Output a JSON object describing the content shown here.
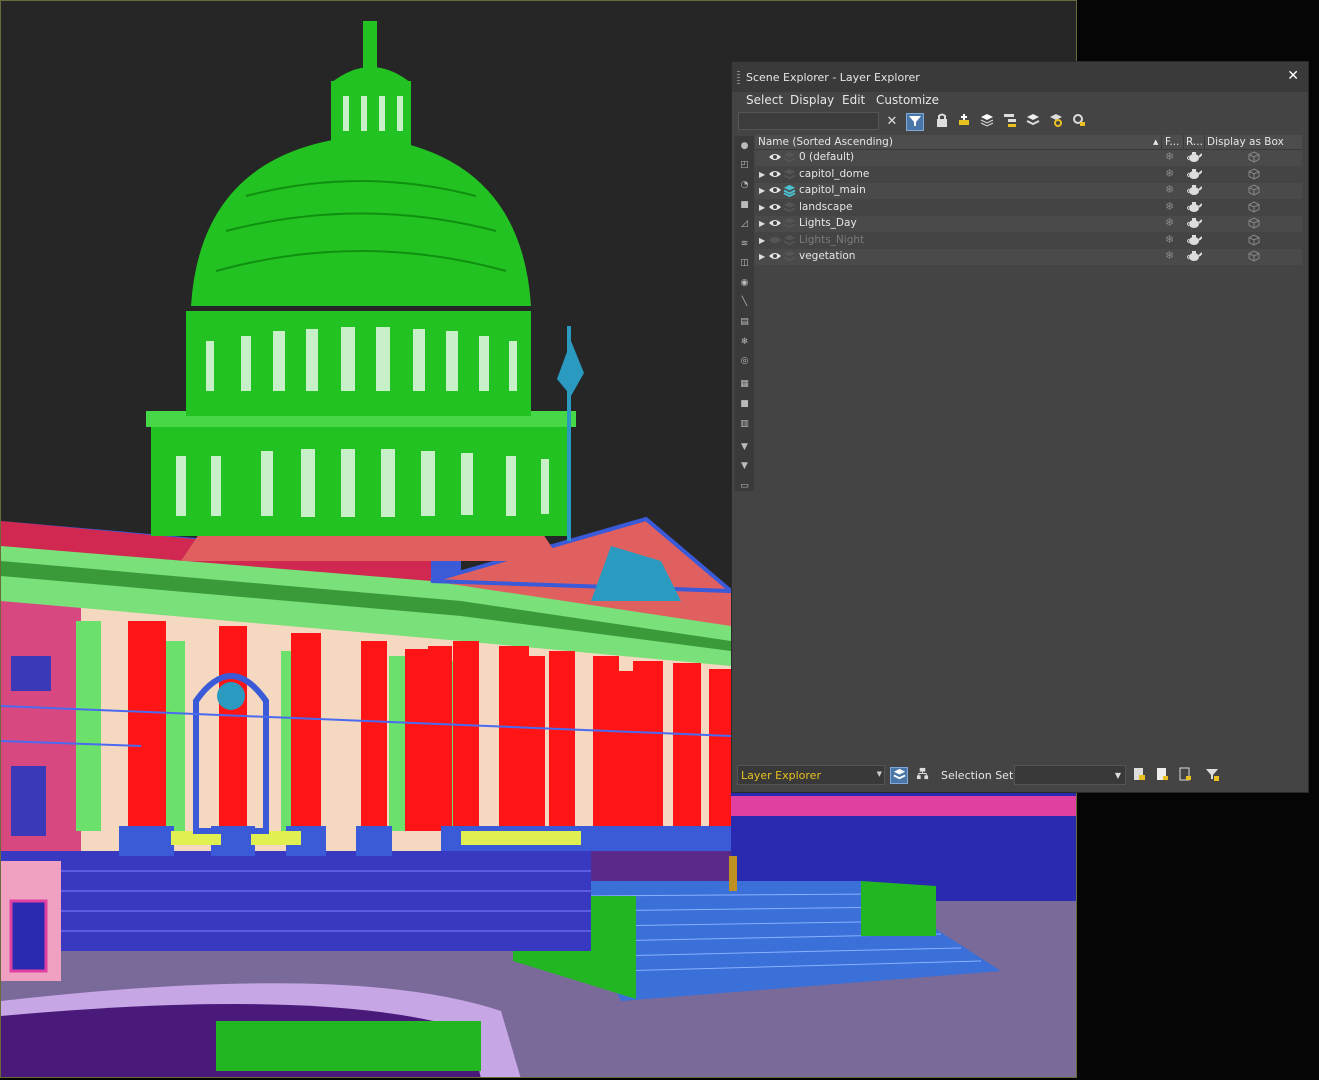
{
  "window": {
    "title": "Scene Explorer - Layer Explorer",
    "close_label": "✕"
  },
  "menu": [
    "Select",
    "Display",
    "Edit",
    "Customize"
  ],
  "search": {
    "value": "",
    "placeholder": ""
  },
  "columns": {
    "name": "Name (Sorted Ascending)",
    "sort_indicator": "▲",
    "freeze": "F...",
    "render": "R...",
    "box": "Display as Box"
  },
  "layers": [
    {
      "name": "0 (default)",
      "expandable": false,
      "visible": true,
      "current": false
    },
    {
      "name": "capitol_dome",
      "expandable": true,
      "visible": true,
      "current": false
    },
    {
      "name": "capitol_main",
      "expandable": true,
      "visible": true,
      "current": true
    },
    {
      "name": "landscape",
      "expandable": true,
      "visible": true,
      "current": false
    },
    {
      "name": "Lights_Day",
      "expandable": true,
      "visible": true,
      "current": false
    },
    {
      "name": "Lights_Night",
      "expandable": true,
      "visible": false,
      "current": false
    },
    {
      "name": "vegetation",
      "expandable": true,
      "visible": true,
      "current": false
    }
  ],
  "bottom": {
    "explorer": "Layer Explorer",
    "selection_set_label": "Selection Set:",
    "selection_set_value": ""
  },
  "icons": {
    "expander": "▶",
    "freeze": "❄",
    "dropdown": "▼"
  }
}
